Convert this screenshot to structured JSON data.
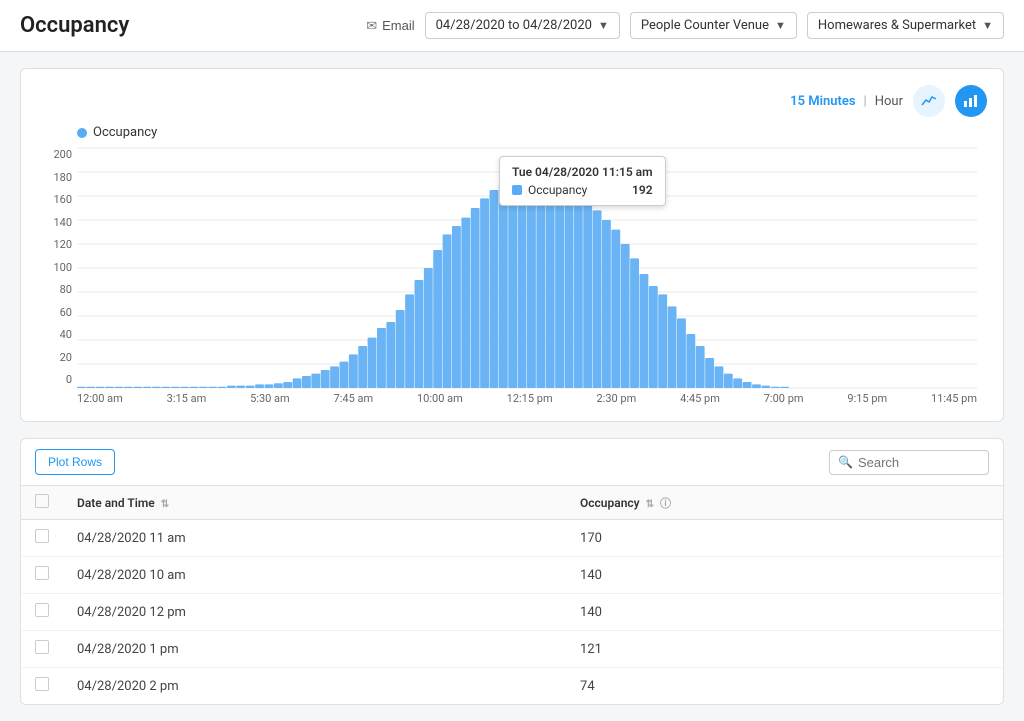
{
  "page": {
    "title": "Occupancy"
  },
  "header": {
    "email_label": "Email",
    "date_range": "04/28/2020 to 04/28/2020",
    "venue_label": "People Counter Venue",
    "store_label": "Homewares & Supermarket"
  },
  "chart": {
    "legend_label": "Occupancy",
    "interval_active": "15 Minutes",
    "interval_divider": "|",
    "interval_inactive": "Hour",
    "tooltip": {
      "title": "Tue 04/28/2020 11:15 am",
      "metric": "Occupancy",
      "value": "192"
    },
    "y_labels": [
      "0",
      "20",
      "40",
      "60",
      "80",
      "100",
      "120",
      "140",
      "160",
      "180",
      "200"
    ],
    "x_labels": [
      "12:00 am",
      "3:15 am",
      "5:30 am",
      "7:45 am",
      "10:00 am",
      "12:15 pm",
      "2:30 pm",
      "4:45 pm",
      "7:00 pm",
      "9:15 pm",
      "11:45 pm"
    ],
    "bars": [
      1,
      1,
      1,
      1,
      1,
      1,
      1,
      1,
      1,
      1,
      1,
      1,
      1,
      1,
      1,
      1,
      2,
      2,
      2,
      3,
      3,
      4,
      5,
      8,
      10,
      12,
      15,
      18,
      22,
      28,
      35,
      42,
      50,
      55,
      65,
      78,
      90,
      100,
      115,
      128,
      135,
      142,
      150,
      158,
      165,
      170,
      175,
      180,
      185,
      192,
      188,
      180,
      175,
      165,
      155,
      148,
      140,
      132,
      120,
      108,
      95,
      85,
      78,
      68,
      58,
      45,
      35,
      25,
      18,
      12,
      8,
      5,
      3,
      2,
      1,
      1,
      0,
      0,
      0,
      0,
      0,
      0,
      0,
      0,
      0,
      0,
      0,
      0,
      0,
      0,
      0,
      0,
      0,
      0,
      0,
      0
    ]
  },
  "table": {
    "plot_rows_label": "Plot Rows",
    "search_placeholder": "Search",
    "columns": [
      {
        "label": "Date and Time",
        "sortable": true
      },
      {
        "label": "Occupancy",
        "sortable": true,
        "info": true
      }
    ],
    "rows": [
      {
        "datetime": "04/28/2020 11 am",
        "occupancy": "170"
      },
      {
        "datetime": "04/28/2020 10 am",
        "occupancy": "140"
      },
      {
        "datetime": "04/28/2020 12 pm",
        "occupancy": "140"
      },
      {
        "datetime": "04/28/2020 1 pm",
        "occupancy": "121"
      },
      {
        "datetime": "04/28/2020 2 pm",
        "occupancy": "74"
      }
    ]
  }
}
